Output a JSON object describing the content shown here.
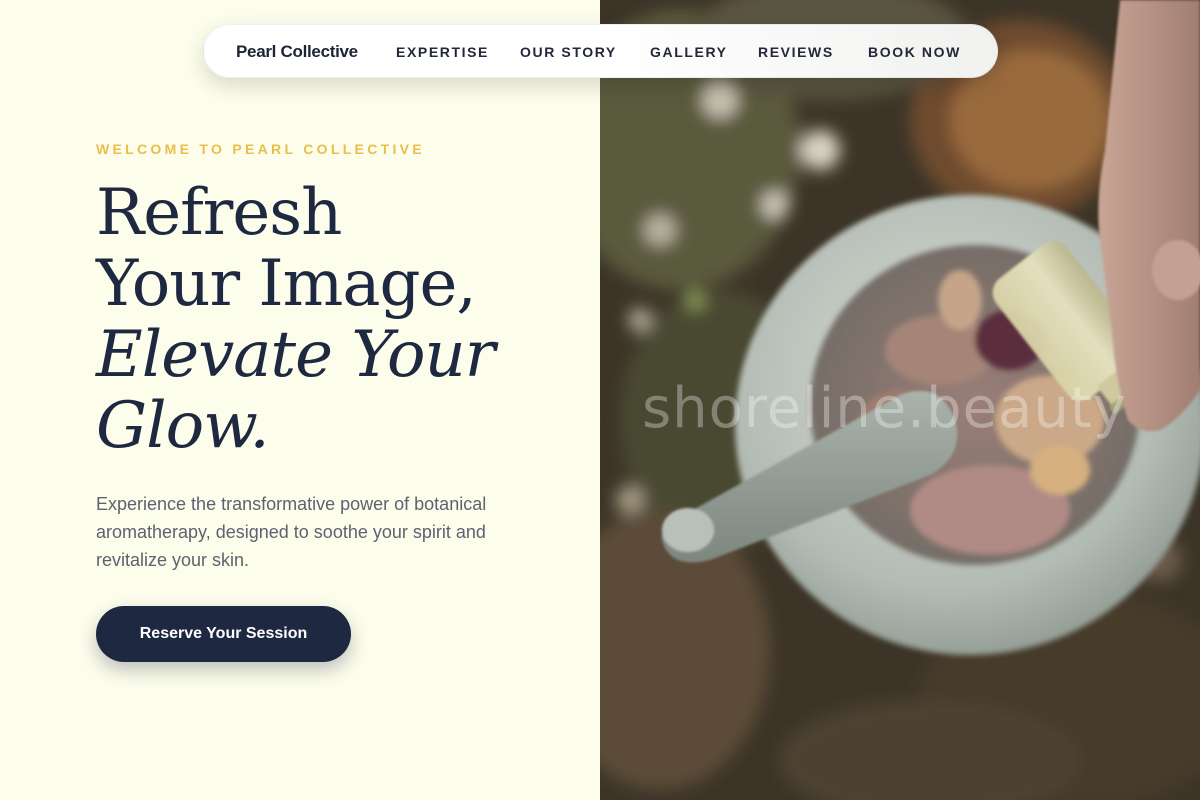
{
  "nav": {
    "brand": "Pearl Collective",
    "links": [
      "EXPERTISE",
      "OUR STORY",
      "GALLERY",
      "REVIEWS",
      "BOOK NOW"
    ]
  },
  "hero": {
    "eyebrow": "WELCOME TO PEARL COLLECTIVE",
    "headline": {
      "line1": "Refresh",
      "line2": "Your Image,",
      "line3": "Elevate Your",
      "line4": "Glow."
    },
    "subtitle": "Experience the transformative power of botanical aromatherapy, designed to soothe your spirit and revitalize your skin.",
    "cta_label": "Reserve Your Session"
  },
  "image": {
    "watermark": "shoreline.beauty"
  },
  "colors": {
    "background": "#fdfdec",
    "accent_gold": "#e9bf4a",
    "navy": "#1e2840"
  }
}
